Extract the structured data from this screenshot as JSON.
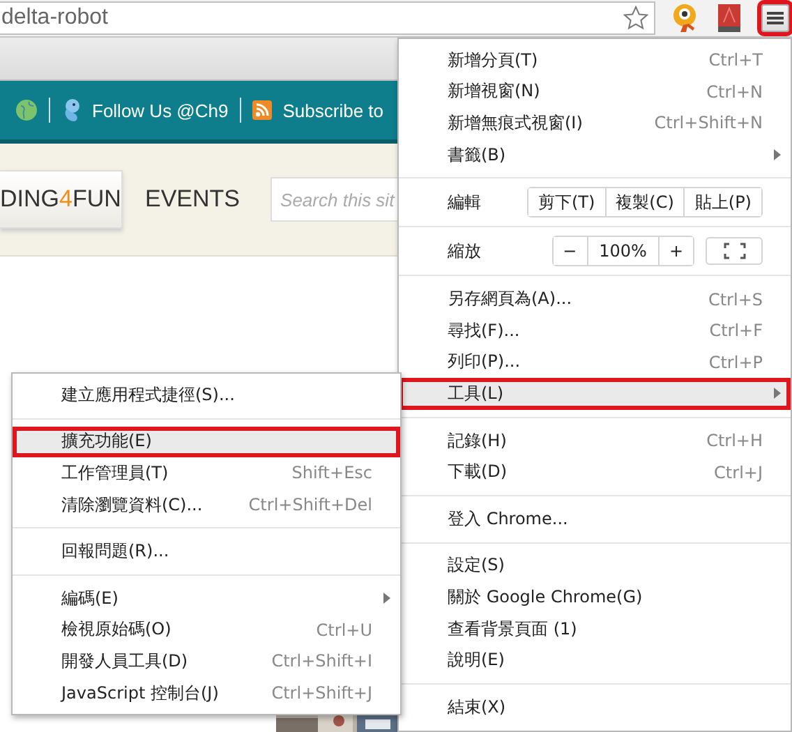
{
  "address_bar": {
    "url": "delta-robot",
    "menu_button_outlined": true
  },
  "site_bar": {
    "links": [
      {
        "kind": "globe"
      },
      {
        "kind": "bird",
        "label": "Follow Us @Ch9"
      },
      {
        "kind": "rss",
        "label": "Subscribe to"
      }
    ]
  },
  "site_nav": {
    "tab": {
      "before": "DING",
      "accent": "4",
      "after": "FUN"
    },
    "link": "EVENTS",
    "search": {
      "placeholder": "Search this sit"
    }
  },
  "menu": {
    "items": [
      {
        "kind": "item",
        "label": "新增分頁(T)",
        "shortcut": "Ctrl+T",
        "selected": false,
        "outlined": false
      },
      {
        "kind": "item",
        "label": "新增視窗(N)",
        "shortcut": "Ctrl+N",
        "selected": false,
        "outlined": false
      },
      {
        "kind": "item",
        "label": "新增無痕式視窗(I)",
        "shortcut": "Ctrl+Shift+N",
        "selected": false,
        "outlined": false
      },
      {
        "kind": "submenu",
        "label": "書籤(B)",
        "selected": false,
        "outlined": false
      },
      {
        "kind": "separator"
      },
      {
        "kind": "edit",
        "label": "編輯",
        "buttons": [
          "剪下(T)",
          "複製(C)",
          "貼上(P)"
        ]
      },
      {
        "kind": "separator"
      },
      {
        "kind": "zoom",
        "label": "縮放",
        "minus": "−",
        "value": "100%",
        "plus": "+"
      },
      {
        "kind": "separator"
      },
      {
        "kind": "item",
        "label": "另存網頁為(A)...",
        "shortcut": "Ctrl+S",
        "selected": false,
        "outlined": false
      },
      {
        "kind": "item",
        "label": "尋找(F)...",
        "shortcut": "Ctrl+F",
        "selected": false,
        "outlined": false
      },
      {
        "kind": "item",
        "label": "列印(P)...",
        "shortcut": "Ctrl+P",
        "selected": false,
        "outlined": false
      },
      {
        "kind": "submenu",
        "label": "工具(L)",
        "selected": true,
        "outlined": true
      },
      {
        "kind": "separator"
      },
      {
        "kind": "item",
        "label": "記錄(H)",
        "shortcut": "Ctrl+H",
        "selected": false,
        "outlined": false
      },
      {
        "kind": "item",
        "label": "下載(D)",
        "shortcut": "Ctrl+J",
        "selected": false,
        "outlined": false
      },
      {
        "kind": "separator"
      },
      {
        "kind": "item",
        "label": "登入 Chrome...",
        "selected": false,
        "outlined": false
      },
      {
        "kind": "separator"
      },
      {
        "kind": "item",
        "label": "設定(S)",
        "selected": false,
        "outlined": false
      },
      {
        "kind": "item",
        "label": "關於 Google Chrome(G)",
        "selected": false,
        "outlined": false
      },
      {
        "kind": "item",
        "label": "查看背景頁面 (1)",
        "selected": false,
        "outlined": false
      },
      {
        "kind": "item",
        "label": "說明(E)",
        "selected": false,
        "outlined": false
      },
      {
        "kind": "separator"
      },
      {
        "kind": "item",
        "label": "結束(X)",
        "selected": false,
        "outlined": false
      }
    ]
  },
  "tools_submenu": {
    "items": [
      {
        "kind": "item",
        "label": "建立應用程式捷徑(S)...",
        "selected": false,
        "outlined": false
      },
      {
        "kind": "separator"
      },
      {
        "kind": "item",
        "label": "擴充功能(E)",
        "selected": true,
        "outlined": true
      },
      {
        "kind": "item",
        "label": "工作管理員(T)",
        "shortcut": "Shift+Esc",
        "selected": false,
        "outlined": false
      },
      {
        "kind": "item",
        "label": "清除瀏覽資料(C)...",
        "shortcut": "Ctrl+Shift+Del",
        "selected": false,
        "outlined": false
      },
      {
        "kind": "separator"
      },
      {
        "kind": "item",
        "label": "回報問題(R)...",
        "selected": false,
        "outlined": false
      },
      {
        "kind": "separator"
      },
      {
        "kind": "submenu",
        "label": "編碼(E)",
        "selected": false,
        "outlined": false
      },
      {
        "kind": "item",
        "label": "檢視原始碼(O)",
        "shortcut": "Ctrl+U",
        "selected": false,
        "outlined": false
      },
      {
        "kind": "item",
        "label": "開發人員工具(D)",
        "shortcut": "Ctrl+Shift+I",
        "selected": false,
        "outlined": false
      },
      {
        "kind": "item",
        "label": "JavaScript 控制台(J)",
        "shortcut": "Ctrl+Shift+J",
        "selected": false,
        "outlined": false
      }
    ]
  }
}
